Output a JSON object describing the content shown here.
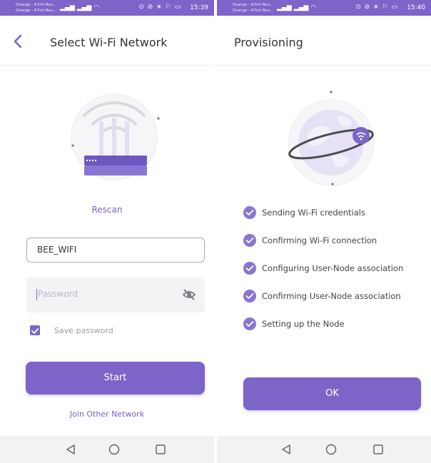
{
  "status_left": {
    "carrier_line1": "Orange - A7ml Rou...",
    "carrier_line2": "Orange - A7ml Rou...",
    "icons": "⊙ ⊘ ∗ ⚐ ▭",
    "time": "15:39"
  },
  "status_right": {
    "carrier_line1": "Orange - A7ml Rou...",
    "carrier_line2": "Orange - A7ml Rou...",
    "icons": "⊙ ⊘ ∗ ⚐ ▭",
    "time": "15:40"
  },
  "wifi_screen": {
    "title": "Select Wi-Fi Network",
    "rescan_label": "Rescan",
    "ssid_value": "BEE_WIFI",
    "password_placeholder": "Password",
    "save_password_label": "Save password",
    "save_password_checked": true,
    "start_label": "Start",
    "join_other_label": "Join Other Network"
  },
  "provisioning_screen": {
    "title": "Provisioning",
    "steps": [
      {
        "label": "Sending Wi-Fi credentials",
        "done": true
      },
      {
        "label": "Confirming Wi-Fi connection",
        "done": true
      },
      {
        "label": "Configuring User-Node association",
        "done": true
      },
      {
        "label": "Confirming User-Node association",
        "done": true
      },
      {
        "label": "Setting up the Node",
        "done": true
      }
    ],
    "ok_label": "OK"
  },
  "colors": {
    "accent": "#7c64c9",
    "accent_light": "#e9e3f7",
    "text": "#333333",
    "muted": "#9c9ca6"
  },
  "navbar": {
    "icons": [
      "back-triangle-icon",
      "home-circle-icon",
      "recents-square-icon"
    ]
  }
}
